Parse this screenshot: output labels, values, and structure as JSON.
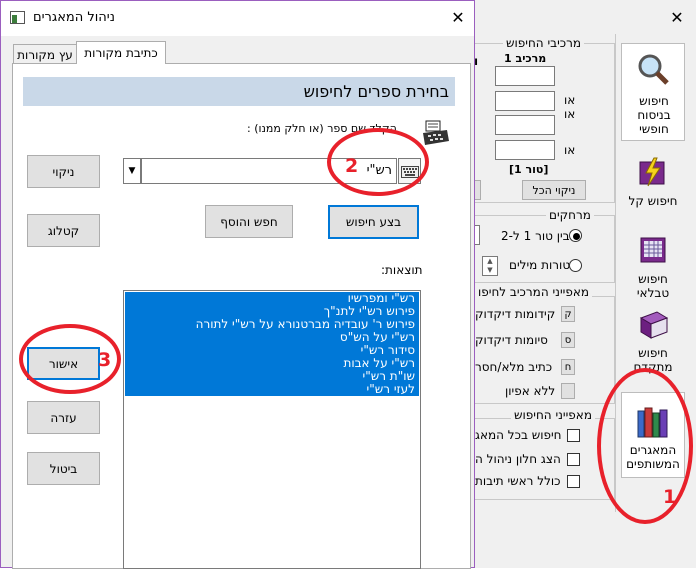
{
  "background_window": {
    "close_glyph": "✕",
    "search_components": {
      "title": "מרכיבי החיפוש",
      "component_label": "מרכיב 1",
      "or_labels": [
        "או",
        "או",
        "או"
      ],
      "partial_letter": "ו",
      "row_label": "[טור 1]",
      "clear_all": "ניקוי הכל"
    },
    "distances": {
      "title": "מרחקים",
      "option1": "בין טור 1 ל-2:",
      "option2": "טורות מילים"
    },
    "component_features": {
      "title": "מאפייני המרכיב לחיפו",
      "items": [
        {
          "key": "ק",
          "label": "קידומות דיקדוק"
        },
        {
          "key": "ס",
          "label": "סיומות דיקדוק"
        },
        {
          "key": "ח",
          "label": "כתיב מלא/חסר"
        },
        {
          "key": "",
          "label": "ללא אפיון"
        }
      ]
    },
    "search_features": {
      "title": "מאפייני החיפוש",
      "items": [
        "חיפוש בכל המאג",
        "הצג חלון ניהול ה",
        "כולל ראשי תיבות"
      ]
    },
    "sidebar": [
      {
        "label": "חיפוש בניסוח חופשי",
        "icon": "magnifier-icon"
      },
      {
        "label": "חיפוש קל",
        "icon": "lightning-book-icon"
      },
      {
        "label": "חיפוש טבלאי",
        "icon": "calendar-book-icon"
      },
      {
        "label": "חיפוש מתקדם",
        "icon": "purple-book-icon"
      },
      {
        "label": "המאגרים המשותפים",
        "icon": "books-icon"
      }
    ]
  },
  "dialog": {
    "title": "ניהול המאגרים",
    "close_glyph": "✕",
    "tabs": [
      {
        "label": "עץ מקורות",
        "active": false
      },
      {
        "label": "כתיבת מקורות",
        "active": true
      }
    ],
    "header": "בחירת ספרים לחיפוש",
    "instruction": "הקלד שם ספר (או חלק ממנו) :",
    "search_value": "רש\"י",
    "buttons": {
      "clear": "ניקוי",
      "catalog": "קטלוג",
      "do_search": "בצע חיפוש",
      "search_and_add": "חפש והוסף",
      "confirm": "אישור",
      "help": "עזרה",
      "cancel": "ביטול"
    },
    "results_label": "תוצאות:",
    "results": [
      "רש\"י ומפרשיו",
      "פירוש רש\"י לתנ\"ך",
      "פירוש ר' עובדיה מברטנורא על רש\"י לתורה",
      "רש\"י על הש\"ס",
      "סידור רש\"י",
      "רש\"י על אבות",
      "שו\"ת רש\"י",
      "לעזי רש\"י"
    ]
  },
  "annotations": {
    "step1": "1",
    "step2": "2",
    "step3": "3"
  },
  "colors": {
    "accent": "#0078d7",
    "annotation_red": "#e8212b",
    "header_bg": "#c9d8e8",
    "dialog_border": "#9b5fbf"
  }
}
